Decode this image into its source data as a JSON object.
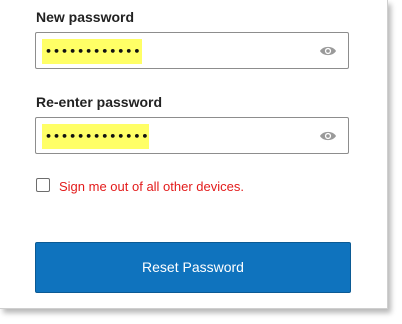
{
  "form": {
    "new_password": {
      "label": "New password",
      "value": "••••••••••••",
      "highlight_color": "#ffff66",
      "toggle_icon": "eye-icon"
    },
    "reenter_password": {
      "label": "Re-enter password",
      "value": "•••••••••••••",
      "highlight_color": "#ffff66",
      "toggle_icon": "eye-icon"
    },
    "sign_out_checkbox": {
      "label": "Sign me out of all other devices.",
      "checked": false,
      "label_color": "#e31b1b"
    },
    "submit": {
      "label": "Reset Password",
      "color": "#0f73be"
    }
  }
}
